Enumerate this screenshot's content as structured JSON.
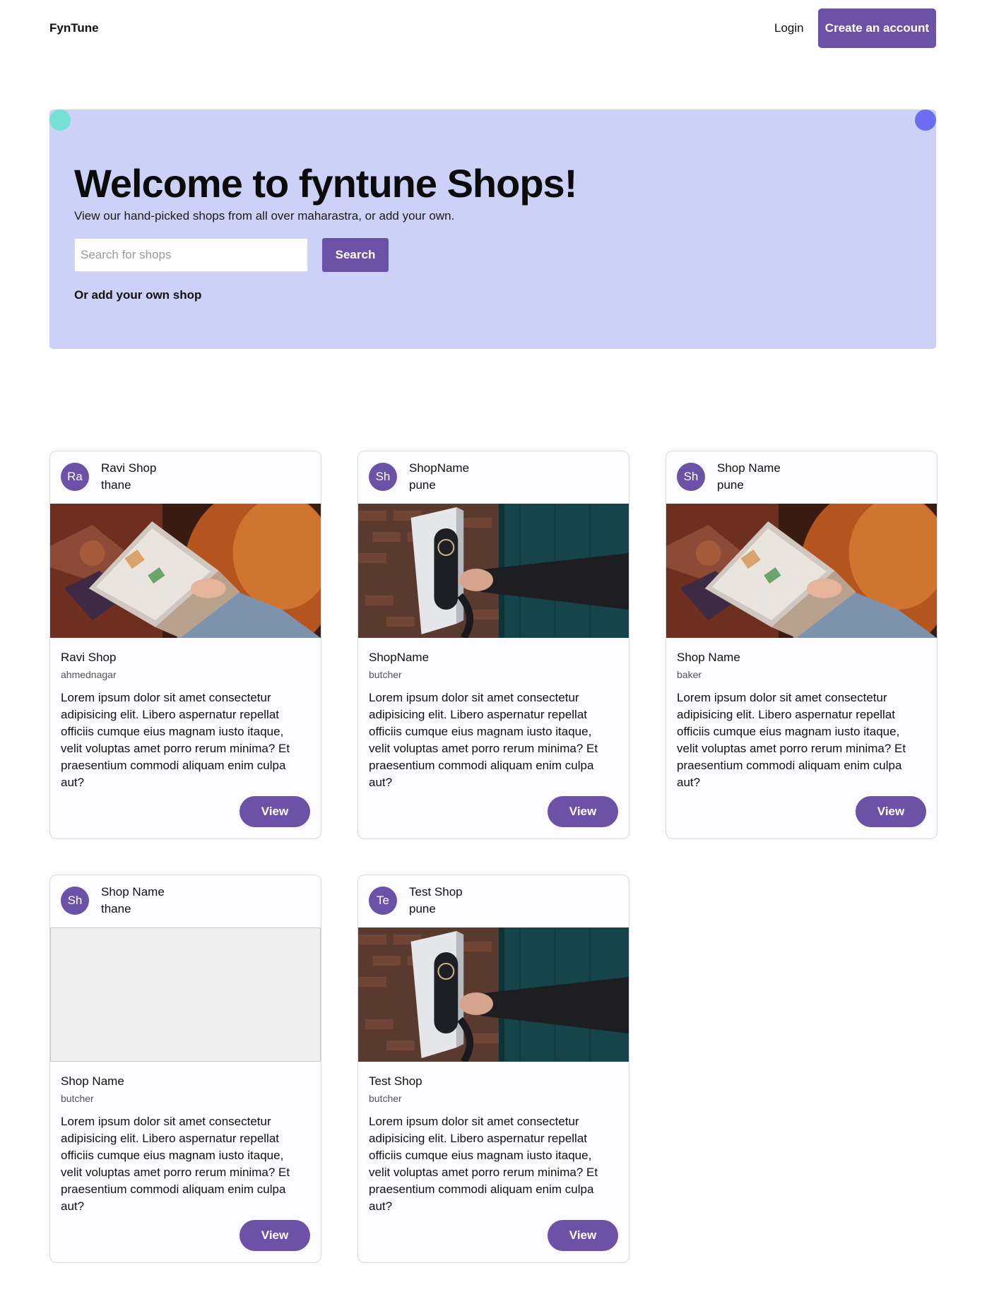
{
  "nav": {
    "brand": "FynTune",
    "login": "Login",
    "create_account": "Create an account"
  },
  "hero": {
    "title": "Welcome to fyntune Shops!",
    "subtitle": "View our hand-picked shops from all over maharastra, or add your own.",
    "search_placeholder": "Search for shops",
    "search_button": "Search",
    "add_link": "Or add your own shop"
  },
  "colors": {
    "primary": "#6b52a7",
    "hero_bg": "#ccd2f7",
    "dot_left": "#77e0d4",
    "dot_right": "#6d6df4"
  },
  "shops": [
    {
      "initials": "Ra",
      "header_name": "Ravi Shop",
      "header_city": "thane",
      "image": "laptop-photo",
      "name": "Ravi Shop",
      "category": "ahmednagar",
      "description": "Lorem ipsum dolor sit amet consectetur adipisicing elit. Libero aspernatur repellat officiis cumque eius magnam iusto itaque, velit voluptas amet porro rerum minima? Et praesentium commodi aliquam enim culpa aut?",
      "view_label": "View"
    },
    {
      "initials": "Sh",
      "header_name": "ShopName",
      "header_city": "pune",
      "image": "charger-photo",
      "name": "ShopName",
      "category": "butcher",
      "description": "Lorem ipsum dolor sit amet consectetur adipisicing elit. Libero aspernatur repellat officiis cumque eius magnam iusto itaque, velit voluptas amet porro rerum minima? Et praesentium commodi aliquam enim culpa aut?",
      "view_label": "View"
    },
    {
      "initials": "Sh",
      "header_name": "Shop Name",
      "header_city": "pune",
      "image": "laptop-photo",
      "name": "Shop Name",
      "category": "baker",
      "description": "Lorem ipsum dolor sit amet consectetur adipisicing elit. Libero aspernatur repellat officiis cumque eius magnam iusto itaque, velit voluptas amet porro rerum minima? Et praesentium commodi aliquam enim culpa aut?",
      "view_label": "View"
    },
    {
      "initials": "Sh",
      "header_name": "Shop Name",
      "header_city": "thane",
      "image": "empty-placeholder",
      "name": "Shop Name",
      "category": "butcher",
      "description": "Lorem ipsum dolor sit amet consectetur adipisicing elit. Libero aspernatur repellat officiis cumque eius magnam iusto itaque, velit voluptas amet porro rerum minima? Et praesentium commodi aliquam enim culpa aut?",
      "view_label": "View"
    },
    {
      "initials": "Te",
      "header_name": "Test Shop",
      "header_city": "pune",
      "image": "charger-photo",
      "name": "Test Shop",
      "category": "butcher",
      "description": "Lorem ipsum dolor sit amet consectetur adipisicing elit. Libero aspernatur repellat officiis cumque eius magnam iusto itaque, velit voluptas amet porro rerum minima? Et praesentium commodi aliquam enim culpa aut?",
      "view_label": "View"
    }
  ]
}
